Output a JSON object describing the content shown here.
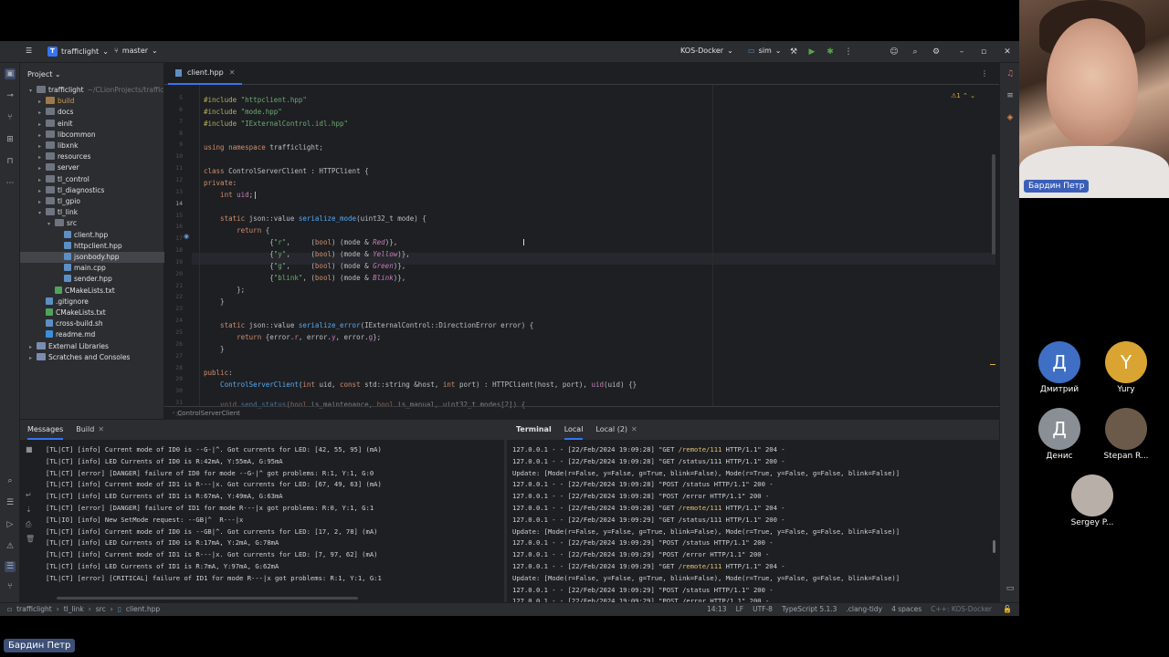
{
  "titlebar": {
    "project_badge": "T",
    "project": "trafficlight",
    "branch": "master",
    "run_config": "KOS-Docker",
    "target": "sim"
  },
  "project_panel": {
    "title": "Project",
    "tree": [
      {
        "label": "trafficlight",
        "sub": "~/CLionProjects/traffic",
        "kind": "folder",
        "depth": 0,
        "open": true
      },
      {
        "label": "build",
        "kind": "excl",
        "depth": 1,
        "open": false,
        "excluded": true
      },
      {
        "label": "docs",
        "kind": "folder",
        "depth": 1,
        "open": false
      },
      {
        "label": "einit",
        "kind": "folder",
        "depth": 1,
        "open": false
      },
      {
        "label": "libcommon",
        "kind": "folder",
        "depth": 1,
        "open": false
      },
      {
        "label": "libxnk",
        "kind": "folder",
        "depth": 1,
        "open": false
      },
      {
        "label": "resources",
        "kind": "folder",
        "depth": 1,
        "open": false
      },
      {
        "label": "server",
        "kind": "folder",
        "depth": 1,
        "open": false
      },
      {
        "label": "tl_control",
        "kind": "folder",
        "depth": 1,
        "open": false
      },
      {
        "label": "tl_diagnostics",
        "kind": "folder",
        "depth": 1,
        "open": false
      },
      {
        "label": "tl_gpio",
        "kind": "folder",
        "depth": 1,
        "open": false
      },
      {
        "label": "tl_link",
        "kind": "folder",
        "depth": 1,
        "open": true
      },
      {
        "label": "src",
        "kind": "folder",
        "depth": 2,
        "open": true
      },
      {
        "label": "client.hpp",
        "kind": "file",
        "depth": 3
      },
      {
        "label": "httpclient.hpp",
        "kind": "file",
        "depth": 3
      },
      {
        "label": "jsonbody.hpp",
        "kind": "file",
        "depth": 3,
        "selected": true
      },
      {
        "label": "main.cpp",
        "kind": "file",
        "depth": 3
      },
      {
        "label": "sender.hpp",
        "kind": "file",
        "depth": 3
      },
      {
        "label": "CMakeLists.txt",
        "kind": "cmake",
        "depth": 2
      },
      {
        "label": ".gitignore",
        "kind": "file",
        "depth": 1
      },
      {
        "label": "CMakeLists.txt",
        "kind": "cmake",
        "depth": 1
      },
      {
        "label": "cross-build.sh",
        "kind": "file",
        "depth": 1
      },
      {
        "label": "readme.md",
        "kind": "md",
        "depth": 1
      },
      {
        "label": "External Libraries",
        "kind": "lib",
        "depth": 0,
        "open": false
      },
      {
        "label": "Scratches and Consoles",
        "kind": "lib",
        "depth": 0,
        "open": false
      }
    ]
  },
  "editor": {
    "tab": "client.hpp",
    "warning_count": "1",
    "breadcrumb": "ControlServerClient",
    "line_numbers": [
      "5",
      "6",
      "7",
      "8",
      "9",
      "10",
      "11",
      "12",
      "13",
      "14",
      "15",
      "16",
      "17",
      "18",
      "19",
      "20",
      "21",
      "22",
      "23",
      "24",
      "25",
      "26",
      "27",
      "28",
      "29",
      "30",
      "31",
      "32"
    ],
    "current_line": "14"
  },
  "messages_panel": {
    "tabs": [
      "Messages",
      "Build"
    ],
    "lines": [
      "[TL|CT] [info] Current mode of ID0 is --G-|^. Got currents for LED: [42, 55, 95] (mA)",
      "[TL|CT] [info] LED Currents of ID0 is R:42mA, Y:55mA, G:95mA",
      "[TL|CT] [error] [DANGER] failure of ID0 for mode --G-|^ got problems: R:1, Y:1, G:0",
      "[TL|CT] [info] Current mode of ID1 is R---|x. Got currents for LED: [67, 49, 63] (mA)",
      "[TL|CT] [info] LED Currents of ID1 is R:67mA, Y:49mA, G:63mA",
      "[TL|CT] [error] [DANGER] failure of ID1 for mode R---|x got problems: R:0, Y:1, G:1",
      "[TL|IO] [info] New SetMode request: --GB|^  R---|x",
      "[TL|CT] [info] Current mode of ID0 is --GB|^. Got currents for LED: [17, 2, 78] (mA)",
      "[TL|CT] [info] LED Currents of ID0 is R:17mA, Y:2mA, G:78mA",
      "[TL|CT] [info] Current mode of ID1 is R---|x. Got currents for LED: [7, 97, 62] (mA)",
      "[TL|CT] [info] LED Currents of ID1 is R:7mA, Y:97mA, G:62mA",
      "[TL|CT] [error] [CRITICAL] failure of ID1 for mode R---|x got problems: R:1, Y:1, G:1"
    ]
  },
  "terminal_panel": {
    "tabs": [
      "Terminal",
      "Local",
      "Local (2)"
    ],
    "lines": [
      {
        "pre": "127.0.0.1 - - [22/Feb/2024 19:09:28] \"GET ",
        "url": "/remote/111",
        "post": " HTTP/1.1\" 204 -"
      },
      {
        "pre": "127.0.0.1 - - [22/Feb/2024 19:09:28] \"GET /status/111 HTTP/1.1\" 200 -",
        "url": "",
        "post": ""
      },
      {
        "pre": "Update: [Mode(r=False, y=False, g=True, blink=False), Mode(r=True, y=False, g=False, blink=False)]",
        "url": "",
        "post": ""
      },
      {
        "pre": "127.0.0.1 - - [22/Feb/2024 19:09:28] \"POST /status HTTP/1.1\" 200 -",
        "url": "",
        "post": ""
      },
      {
        "pre": "127.0.0.1 - - [22/Feb/2024 19:09:28] \"POST /error HTTP/1.1\" 200 -",
        "url": "",
        "post": ""
      },
      {
        "pre": "127.0.0.1 - - [22/Feb/2024 19:09:28] \"GET ",
        "url": "/remote/111",
        "post": " HTTP/1.1\" 204 -"
      },
      {
        "pre": "127.0.0.1 - - [22/Feb/2024 19:09:29] \"GET /status/111 HTTP/1.1\" 200 -",
        "url": "",
        "post": ""
      },
      {
        "pre": "Update: [Mode(r=False, y=False, g=True, blink=False), Mode(r=True, y=False, g=False, blink=False)]",
        "url": "",
        "post": ""
      },
      {
        "pre": "127.0.0.1 - - [22/Feb/2024 19:09:29] \"POST /status HTTP/1.1\" 200 -",
        "url": "",
        "post": ""
      },
      {
        "pre": "127.0.0.1 - - [22/Feb/2024 19:09:29] \"POST /error HTTP/1.1\" 200 -",
        "url": "",
        "post": ""
      },
      {
        "pre": "127.0.0.1 - - [22/Feb/2024 19:09:29] \"GET ",
        "url": "/remote/111",
        "post": " HTTP/1.1\" 204 -"
      },
      {
        "pre": "Update: [Mode(r=False, y=False, g=True, blink=False), Mode(r=True, y=False, g=False, blink=False)]",
        "url": "",
        "post": ""
      },
      {
        "pre": "127.0.0.1 - - [22/Feb/2024 19:09:29] \"POST /status HTTP/1.1\" 200 -",
        "url": "",
        "post": ""
      },
      {
        "pre": "127.0.0.1 - - [22/Feb/2024 19:09:29] \"POST /error HTTP/1.1\" 200 -",
        "url": "",
        "post": ""
      }
    ]
  },
  "statusbar": {
    "crumbs": [
      "trafficlight",
      "tl_link",
      "src",
      "client.hpp"
    ],
    "position": "14:13",
    "line_sep": "LF",
    "encoding": "UTF-8",
    "lang": "TypeScript 5.1.3",
    "linter": ".clang-tidy",
    "indent": "4 spaces",
    "context": "C++: KOS-Docker"
  },
  "call": {
    "speaker_name": "Бардин Петр",
    "bottom_name": "Бардин Петр",
    "participants": [
      {
        "initial": "Д",
        "name": "Дмитрий",
        "color": "#3f6fc4"
      },
      {
        "initial": "Y",
        "name": "Yury",
        "color": "#d9a432"
      },
      {
        "initial": "Д",
        "name": "Денис",
        "color": "#8a8f96"
      },
      {
        "initial": "",
        "name": "Stepan R...",
        "color": "#6b5a4a"
      },
      {
        "initial": "",
        "name": "Sergey P...",
        "color": "#b8b0a8"
      }
    ]
  },
  "colors": {
    "accent": "#3574f0",
    "editor_bg": "#1e1f22",
    "panel_bg": "#2b2d30"
  }
}
